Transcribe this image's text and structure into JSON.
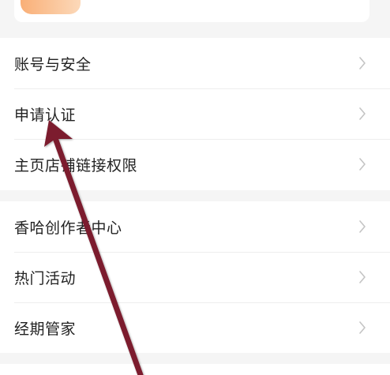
{
  "settings": {
    "group1": [
      {
        "label": "账号与安全"
      },
      {
        "label": "申请认证"
      },
      {
        "label": "主页店铺链接权限"
      }
    ],
    "group2": [
      {
        "label": "香哈创作者中心"
      },
      {
        "label": "热门活动"
      },
      {
        "label": "经期管家"
      }
    ]
  },
  "colors": {
    "background": "#f5f5f5",
    "card": "#ffffff",
    "text": "#222222",
    "chevron": "#c4c4c4",
    "annotation_arrow": "#7b1e2e",
    "header_accent": "#f8a15f"
  },
  "icons": {
    "row_chevron": "chevron-right-icon",
    "annotation": "annotation-arrow"
  }
}
